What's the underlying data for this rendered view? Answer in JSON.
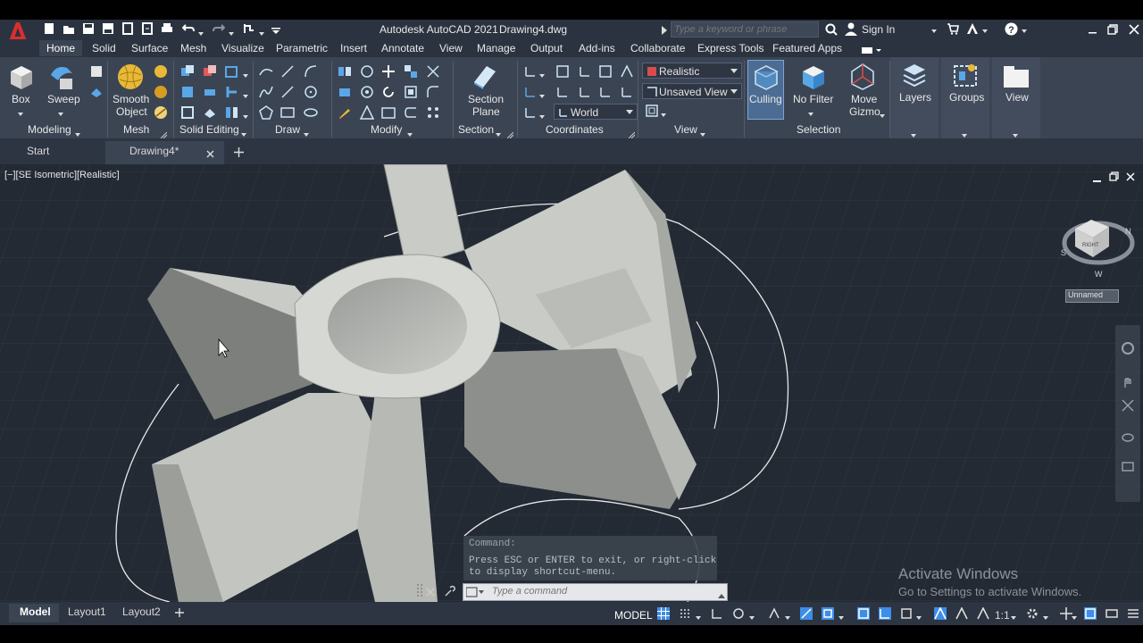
{
  "app": {
    "title": "Autodesk AutoCAD 2021",
    "filename": "Drawing4.dwg",
    "search_placeholder": "Type a keyword or phrase",
    "sign_in": "Sign In"
  },
  "menu_tabs": [
    "Home",
    "Solid",
    "Surface",
    "Mesh",
    "Visualize",
    "Parametric",
    "Insert",
    "Annotate",
    "View",
    "Manage",
    "Output",
    "Add-ins",
    "Collaborate",
    "Express Tools",
    "Featured Apps"
  ],
  "ribbon": {
    "modeling": {
      "title": "Modeling",
      "box": "Box",
      "sweep": "Sweep"
    },
    "mesh": {
      "title": "Mesh",
      "smooth": "Smooth",
      "object": "Object"
    },
    "solid_editing": {
      "title": "Solid Editing"
    },
    "draw": {
      "title": "Draw"
    },
    "modify": {
      "title": "Modify"
    },
    "section": {
      "title": "Section",
      "plane_1": "Section",
      "plane_2": "Plane"
    },
    "coordinates": {
      "title": "Coordinates",
      "ucs": "World"
    },
    "view": {
      "title": "View",
      "visual_style": "Realistic",
      "saved_view": "Unsaved View"
    },
    "selection": {
      "title": "Selection",
      "culling": "Culling",
      "no_filter": "No Filter",
      "move_1": "Move",
      "move_2": "Gizmo"
    },
    "layers": "Layers",
    "groups": "Groups",
    "view_btn": "View"
  },
  "file_tabs": {
    "start": "Start",
    "drawing": "Drawing4*"
  },
  "viewport": {
    "label": "[−][SE Isometric][Realistic]",
    "viewcube_face": "RIGHT",
    "wcs_label": "Unnamed"
  },
  "command": {
    "history_1": "Command:",
    "history_2": "Press ESC or ENTER to exit, or right-click",
    "history_3": "to display shortcut-menu.",
    "placeholder": "Type a command"
  },
  "watermark": {
    "line1": "Activate Windows",
    "line2": "Go to Settings to activate Windows."
  },
  "layout_tabs": [
    "Model",
    "Layout1",
    "Layout2"
  ],
  "status": {
    "model": "MODEL",
    "scale": "1:1"
  },
  "colors": {
    "accent": "#3d8ee8",
    "titlebar": "#2b3340",
    "ribbon": "#3b4453",
    "viewport": "#232a33",
    "logo": "#d92f2f"
  }
}
